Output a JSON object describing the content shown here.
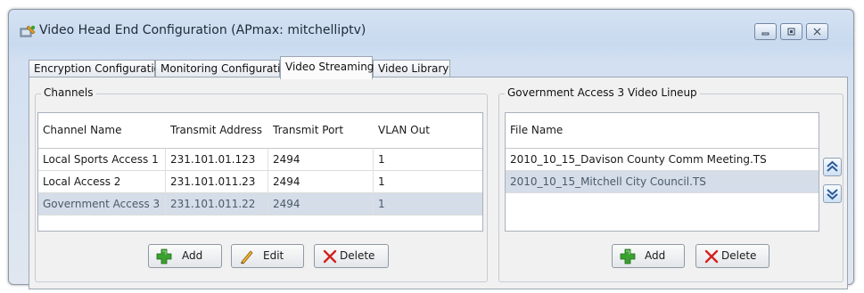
{
  "window": {
    "title": "Video Head End Configuration (APmax: mitchelliptv)",
    "icon": "app-config-icon",
    "controls": [
      "minimize-icon",
      "maximize-icon",
      "close-icon"
    ]
  },
  "tabs": [
    {
      "label": "Encryption Configuration",
      "active": false
    },
    {
      "label": "Monitoring Configuration",
      "active": false
    },
    {
      "label": "Video Streaming",
      "active": true
    },
    {
      "label": "Video Library",
      "active": false
    }
  ],
  "channels": {
    "title": "Channels",
    "columns": [
      "Channel Name",
      "Transmit Address",
      "Transmit Port",
      "VLAN Out"
    ],
    "rows": [
      {
        "name": "Local Sports Access 1",
        "address": "231.101.01.123",
        "port": "2494",
        "vlan": "1",
        "selected": false
      },
      {
        "name": "Local Access 2",
        "address": "231.101.011.23",
        "port": "2494",
        "vlan": "1",
        "selected": false
      },
      {
        "name": "Government  Access 3",
        "address": "231.101.011.22",
        "port": "2494",
        "vlan": "1",
        "selected": true
      }
    ],
    "buttons": {
      "add": "Add",
      "edit": "Edit",
      "delete": "Delete"
    }
  },
  "lineup": {
    "title": "Government  Access 3 Video Lineup",
    "column": "File Name",
    "rows": [
      {
        "file": "2010_10_15_Davison County Comm Meeting.TS",
        "selected": false
      },
      {
        "file": "2010_10_15_Mitchell City Council.TS",
        "selected": true
      }
    ],
    "buttons": {
      "add": "Add",
      "delete": "Delete"
    },
    "move_icons": [
      "move-up-icon",
      "move-down-icon"
    ]
  },
  "colors": {
    "selection": "#d4dde8",
    "title_bar": "#c9daef",
    "add_icon": "#3aa02f",
    "delete_icon": "#d42020",
    "edit_icon": "#e0a020",
    "arrow_icon": "#2a5a9a"
  }
}
